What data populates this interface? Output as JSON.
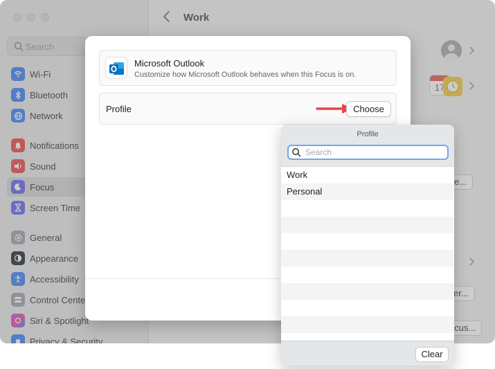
{
  "window": {
    "title": "Work",
    "search_placeholder": "Search"
  },
  "sidebar": {
    "items": [
      {
        "label": "Wi-Fi",
        "icon": "wifi-icon",
        "color": "#3b82f6"
      },
      {
        "label": "Bluetooth",
        "icon": "bluetooth-icon",
        "color": "#3b82f6"
      },
      {
        "label": "Network",
        "icon": "globe-icon",
        "color": "#3b82f6"
      },
      {
        "label": "Notifications",
        "icon": "bell-icon",
        "color": "#ef4444"
      },
      {
        "label": "Sound",
        "icon": "speaker-icon",
        "color": "#ef4444"
      },
      {
        "label": "Focus",
        "icon": "moon-icon",
        "color": "#6366f1"
      },
      {
        "label": "Screen Time",
        "icon": "hourglass-icon",
        "color": "#6366f1"
      },
      {
        "label": "General",
        "icon": "gear-icon",
        "color": "#9ca3af"
      },
      {
        "label": "Appearance",
        "icon": "appearance-icon",
        "color": "#1f2937"
      },
      {
        "label": "Accessibility",
        "icon": "accessibility-icon",
        "color": "#3b82f6"
      },
      {
        "label": "Control Center",
        "icon": "control-center-icon",
        "color": "#9ca3af"
      },
      {
        "label": "Siri & Spotlight",
        "icon": "siri-icon",
        "color": "#a855f7"
      },
      {
        "label": "Privacy & Security",
        "icon": "hand-icon",
        "color": "#3b82f6"
      }
    ]
  },
  "background_buttons": {
    "b1": "le...",
    "b2": "er...",
    "b3": "ocus..."
  },
  "calendar_day": "17",
  "sheet": {
    "app_name": "Microsoft Outlook",
    "app_description": "Customize how Microsoft Outlook behaves when this Focus is on.",
    "profile_label": "Profile",
    "choose_label": "Choose"
  },
  "popover": {
    "title": "Profile",
    "search_placeholder": "Search",
    "options": [
      "Work",
      "Personal"
    ],
    "clear_label": "Clear"
  },
  "colors": {
    "accent": "#6fa8f0",
    "arrow": "#e8424c",
    "outlook_blue": "#0f6cbd"
  }
}
